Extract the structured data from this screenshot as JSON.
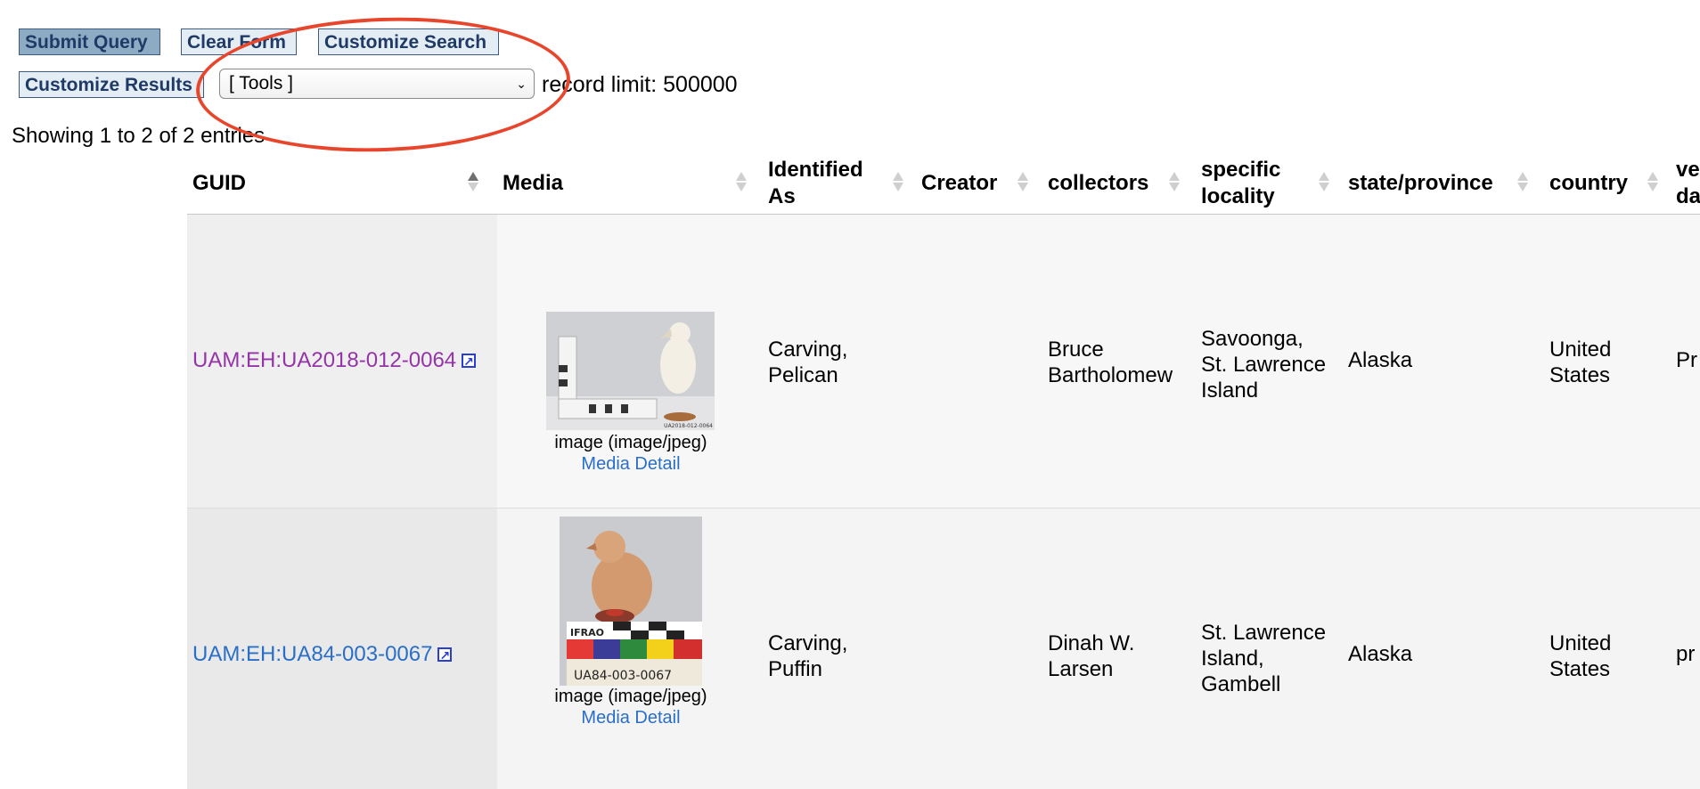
{
  "toolbar": {
    "submit_label": "Submit Query",
    "clear_label": "Clear Form",
    "customize_search_label": "Customize Search",
    "customize_results_label": "Customize Results",
    "tools_select_value": "[ Tools ]",
    "record_limit_text": "record limit: 500000"
  },
  "summary": {
    "showing_text": "Showing 1 to 2 of 2 entries"
  },
  "table": {
    "columns": [
      {
        "label": "GUID",
        "sort": "asc"
      },
      {
        "label": "Media",
        "sort": "none"
      },
      {
        "label": "Identified As",
        "sort": "none"
      },
      {
        "label": "Creator",
        "sort": "none"
      },
      {
        "label": "collectors",
        "sort": "none"
      },
      {
        "label": "specific locality",
        "sort": "none"
      },
      {
        "label": "state/province",
        "sort": "none"
      },
      {
        "label": "country",
        "sort": "none"
      },
      {
        "label": "ve da",
        "sort": "none"
      }
    ],
    "col_labels": {
      "guid": "GUID",
      "media": "Media",
      "identified_as_1": "Identified",
      "identified_as_2": "As",
      "creator": "Creator",
      "collectors": "collectors",
      "locality_1": "specific",
      "locality_2": "locality",
      "state": "state/province",
      "country": "country",
      "verbatim_1": "ve",
      "verbatim_2": "da"
    },
    "rows": [
      {
        "guid": "UAM:EH:UA2018-012-0064",
        "media_caption": "image (image/jpeg)",
        "media_link": "Media Detail",
        "identified_as_1": "Carving,",
        "identified_as_2": "Pelican",
        "creator": "",
        "collectors_1": "Bruce",
        "collectors_2": "Bartholomew",
        "locality_1": "Savoonga,",
        "locality_2": "St. Lawrence",
        "locality_3": "Island",
        "state": "Alaska",
        "country_1": "United",
        "country_2": "States",
        "verbatim": "Pr"
      },
      {
        "guid": "UAM:EH:UA84-003-0067",
        "media_caption": "image (image/jpeg)",
        "media_link": "Media Detail",
        "identified_as_1": "Carving,",
        "identified_as_2": "Puffin",
        "creator": "",
        "collectors_1": "Dinah W.",
        "collectors_2": "Larsen",
        "locality_1": "St. Lawrence",
        "locality_2": "Island,",
        "locality_3": "Gambell",
        "state": "Alaska",
        "country_1": "United",
        "country_2": "States",
        "verbatim": "pr"
      }
    ]
  },
  "thumbnails": {
    "row1_label": "UA2018-012-0064",
    "row2_label": "UA84-003-0067",
    "row2_card_text": "IFRAO"
  },
  "colors": {
    "annotation_circle": "#e8462c",
    "link_visited": "#9533a8",
    "link": "#2a6fc7",
    "button_primary": "#8eabc4"
  }
}
